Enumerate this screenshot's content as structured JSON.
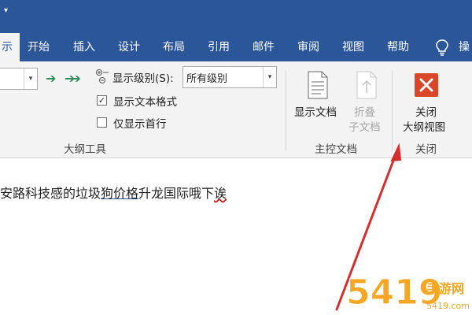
{
  "qat": {
    "arrow": "▾"
  },
  "tabs": [
    {
      "label": "示",
      "active": true
    },
    {
      "label": "开始"
    },
    {
      "label": "插入"
    },
    {
      "label": "设计"
    },
    {
      "label": "布局"
    },
    {
      "label": "引用"
    },
    {
      "label": "邮件"
    },
    {
      "label": "审阅"
    },
    {
      "label": "视图"
    },
    {
      "label": "帮助"
    },
    {
      "label": "操"
    }
  ],
  "ribbon": {
    "outline_tools": {
      "level_combo_value": "",
      "show_level_label": "显示级别(S):",
      "show_level_value": "所有级别",
      "show_text_format_label": "显示文本格式",
      "show_text_format_checked": true,
      "show_first_line_label": "仅显示首行",
      "show_first_line_checked": false,
      "group_label": "大纲工具"
    },
    "master_doc": {
      "show_doc_label": "显示文档",
      "collapse_line1": "折叠",
      "collapse_line2": "子文档",
      "group_label": "主控文档"
    },
    "close": {
      "line1": "关闭",
      "line2": "大纲视图",
      "group_label": "关闭",
      "icon": "close-x-icon",
      "icon_color": "#d9472b"
    }
  },
  "document": {
    "text_before": "安路科技感的垃圾",
    "text_underlined": "狗价格",
    "text_middle": "升龙国际哦下",
    "text_squiggle": "诶"
  },
  "colors": {
    "titlebar": "#2b579a",
    "ribbon": "#f3f3f3",
    "annotation_arrow": "#d32f2f",
    "watermark_orange": "#f5a623"
  },
  "watermark": {
    "text": "5419手游网",
    "subtext": "5419.com"
  }
}
